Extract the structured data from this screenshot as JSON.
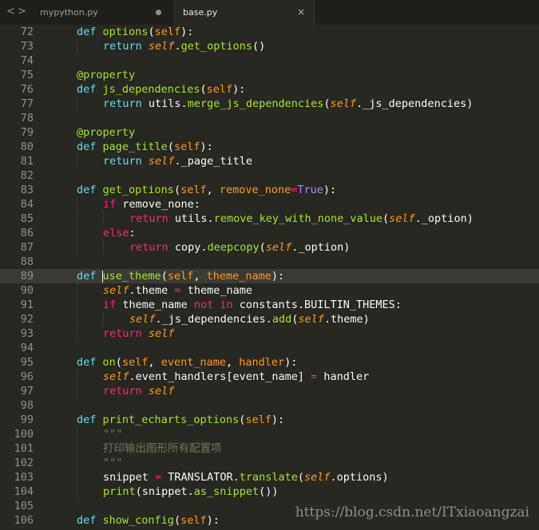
{
  "nav": {
    "back": "<",
    "forward": ">"
  },
  "tabs": [
    {
      "label": "mypython.py",
      "active": false
    },
    {
      "label": "base.py",
      "active": true
    }
  ],
  "tab_close": "×",
  "watermark": "https://blog.csdn.net/ITxiaoangzai",
  "colors": {
    "background": "#272822",
    "keyword": "#66d9ef",
    "operator": "#f92672",
    "function": "#a6e22e",
    "parameter": "#fd971f",
    "comment": "#75715e",
    "text": "#f8f8f2"
  },
  "icons": {
    "modified": "modified-dot-icon",
    "close": "close-icon",
    "back": "chevron-left-icon",
    "forward": "chevron-right-icon"
  },
  "lines": [
    {
      "no": "72",
      "tokens": [
        [
          "k",
          "def"
        ],
        [
          "n",
          " "
        ],
        [
          "fn",
          "options"
        ],
        [
          "n",
          "("
        ],
        [
          "p",
          "self"
        ],
        [
          "n",
          "):"
        ]
      ]
    },
    {
      "no": "73",
      "tokens": [
        [
          "k",
          "return"
        ],
        [
          "n",
          " "
        ],
        [
          "sf",
          "self"
        ],
        [
          "n",
          "."
        ],
        [
          "fn",
          "get_options"
        ],
        [
          "n",
          "()"
        ]
      ]
    },
    {
      "no": "74",
      "tokens": []
    },
    {
      "no": "75",
      "tokens": [
        [
          "fn",
          "@property"
        ]
      ]
    },
    {
      "no": "76",
      "tokens": [
        [
          "k",
          "def"
        ],
        [
          "n",
          " "
        ],
        [
          "fn",
          "js_dependencies"
        ],
        [
          "n",
          "("
        ],
        [
          "p",
          "self"
        ],
        [
          "n",
          "):"
        ]
      ]
    },
    {
      "no": "77",
      "tokens": [
        [
          "k",
          "return"
        ],
        [
          "n",
          " utils."
        ],
        [
          "fn",
          "merge_js_dependencies"
        ],
        [
          "n",
          "("
        ],
        [
          "sf",
          "self"
        ],
        [
          "n",
          "._js_dependencies)"
        ]
      ]
    },
    {
      "no": "78",
      "tokens": []
    },
    {
      "no": "79",
      "tokens": [
        [
          "fn",
          "@property"
        ]
      ]
    },
    {
      "no": "80",
      "tokens": [
        [
          "k",
          "def"
        ],
        [
          "n",
          " "
        ],
        [
          "fn",
          "page_title"
        ],
        [
          "n",
          "("
        ],
        [
          "p",
          "self"
        ],
        [
          "n",
          "):"
        ]
      ]
    },
    {
      "no": "81",
      "tokens": [
        [
          "k",
          "return"
        ],
        [
          "n",
          " "
        ],
        [
          "sf",
          "self"
        ],
        [
          "n",
          "._page_title"
        ]
      ]
    },
    {
      "no": "82",
      "tokens": []
    },
    {
      "no": "83",
      "tokens": [
        [
          "k",
          "def"
        ],
        [
          "n",
          " "
        ],
        [
          "fn",
          "get_options"
        ],
        [
          "n",
          "("
        ],
        [
          "p",
          "self"
        ],
        [
          "n",
          ", "
        ],
        [
          "p",
          "remove_none"
        ],
        [
          "s",
          "="
        ],
        [
          "num",
          "True"
        ],
        [
          "n",
          "):"
        ]
      ]
    },
    {
      "no": "84",
      "tokens": [
        [
          "s",
          "if"
        ],
        [
          "n",
          " remove_none:"
        ]
      ]
    },
    {
      "no": "85",
      "tokens": [
        [
          "s",
          "return"
        ],
        [
          "n",
          " utils."
        ],
        [
          "fn",
          "remove_key_with_none_value"
        ],
        [
          "n",
          "("
        ],
        [
          "sf",
          "self"
        ],
        [
          "n",
          "._option)"
        ]
      ]
    },
    {
      "no": "86",
      "tokens": [
        [
          "s",
          "else"
        ],
        [
          "n",
          ":"
        ]
      ]
    },
    {
      "no": "87",
      "tokens": [
        [
          "s",
          "return"
        ],
        [
          "n",
          " copy."
        ],
        [
          "fn",
          "deepcopy"
        ],
        [
          "n",
          "("
        ],
        [
          "sf",
          "self"
        ],
        [
          "n",
          "._option)"
        ]
      ]
    },
    {
      "no": "88",
      "tokens": []
    },
    {
      "no": "89",
      "tokens": [
        [
          "k",
          "def"
        ],
        [
          "n",
          " "
        ],
        [
          "fn",
          "use_theme"
        ],
        [
          "n",
          "("
        ],
        [
          "p",
          "self"
        ],
        [
          "n",
          ", "
        ],
        [
          "p",
          "theme_name"
        ],
        [
          "n",
          "):"
        ]
      ]
    },
    {
      "no": "90",
      "tokens": [
        [
          "sf",
          "self"
        ],
        [
          "n",
          ".theme "
        ],
        [
          "s",
          "="
        ],
        [
          "n",
          " theme_name"
        ]
      ]
    },
    {
      "no": "91",
      "tokens": [
        [
          "s",
          "if"
        ],
        [
          "n",
          " theme_name "
        ],
        [
          "s",
          "not in"
        ],
        [
          "n",
          " constants.BUILTIN_THEMES:"
        ]
      ]
    },
    {
      "no": "92",
      "tokens": [
        [
          "sf",
          "self"
        ],
        [
          "n",
          "._js_dependencies."
        ],
        [
          "fn",
          "add"
        ],
        [
          "n",
          "("
        ],
        [
          "sf",
          "self"
        ],
        [
          "n",
          ".theme)"
        ]
      ]
    },
    {
      "no": "93",
      "tokens": [
        [
          "s",
          "return"
        ],
        [
          "n",
          " "
        ],
        [
          "sf",
          "self"
        ]
      ]
    },
    {
      "no": "94",
      "tokens": []
    },
    {
      "no": "95",
      "tokens": [
        [
          "k",
          "def"
        ],
        [
          "n",
          " "
        ],
        [
          "fn",
          "on"
        ],
        [
          "n",
          "("
        ],
        [
          "p",
          "self"
        ],
        [
          "n",
          ", "
        ],
        [
          "p",
          "event_name"
        ],
        [
          "n",
          ", "
        ],
        [
          "p",
          "handler"
        ],
        [
          "n",
          "):"
        ]
      ]
    },
    {
      "no": "96",
      "tokens": [
        [
          "sf",
          "self"
        ],
        [
          "n",
          ".event_handlers[event_name] "
        ],
        [
          "s",
          "="
        ],
        [
          "n",
          " handler"
        ]
      ]
    },
    {
      "no": "97",
      "tokens": [
        [
          "s",
          "return"
        ],
        [
          "n",
          " "
        ],
        [
          "sf",
          "self"
        ]
      ]
    },
    {
      "no": "98",
      "tokens": []
    },
    {
      "no": "99",
      "tokens": [
        [
          "k",
          "def"
        ],
        [
          "n",
          " "
        ],
        [
          "fn",
          "print_echarts_options"
        ],
        [
          "n",
          "("
        ],
        [
          "p",
          "self"
        ],
        [
          "n",
          "):"
        ]
      ]
    },
    {
      "no": "100",
      "tokens": [
        [
          "c",
          "\"\"\""
        ]
      ]
    },
    {
      "no": "101",
      "tokens": [
        [
          "c",
          "打印输出图形所有配置项"
        ]
      ]
    },
    {
      "no": "102",
      "tokens": [
        [
          "c",
          "\"\"\""
        ]
      ]
    },
    {
      "no": "103",
      "tokens": [
        [
          "n",
          "snippet "
        ],
        [
          "s",
          "="
        ],
        [
          "n",
          " TRANSLATOR."
        ],
        [
          "fn",
          "translate"
        ],
        [
          "n",
          "("
        ],
        [
          "sf",
          "self"
        ],
        [
          "n",
          ".options)"
        ]
      ]
    },
    {
      "no": "104",
      "tokens": [
        [
          "fn",
          "print"
        ],
        [
          "n",
          "(snippet."
        ],
        [
          "fn",
          "as_snippet"
        ],
        [
          "n",
          "())"
        ]
      ]
    },
    {
      "no": "105",
      "tokens": []
    },
    {
      "no": "106",
      "tokens": [
        [
          "k",
          "def"
        ],
        [
          "n",
          " "
        ],
        [
          "fn",
          "show_config"
        ],
        [
          "n",
          "("
        ],
        [
          "p",
          "self"
        ],
        [
          "n",
          "):"
        ]
      ]
    }
  ]
}
